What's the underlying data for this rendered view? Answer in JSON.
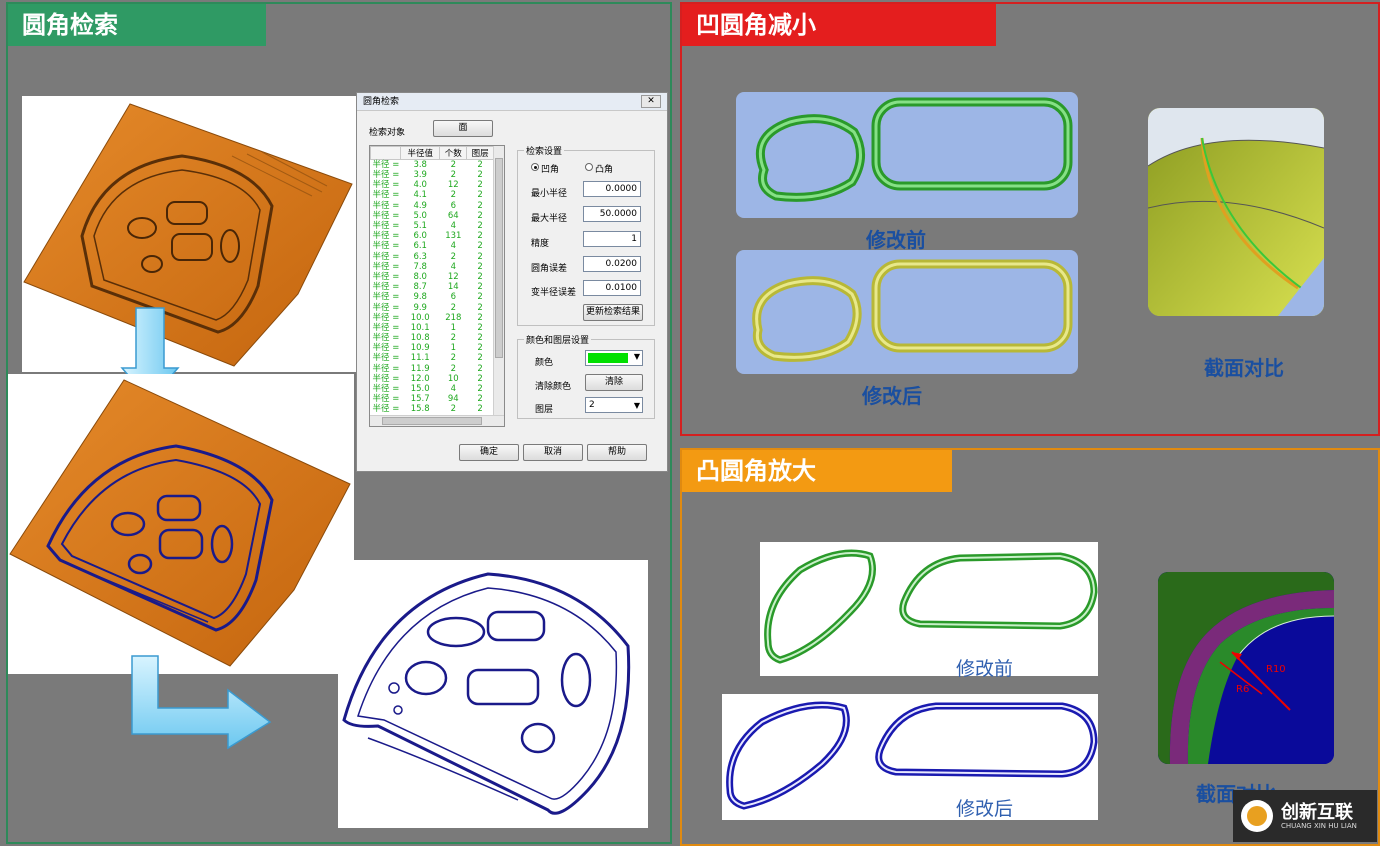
{
  "left_panel": {
    "title": "圆角检索"
  },
  "dialog": {
    "title": "圆角检索",
    "close_icon": "close-icon",
    "search_target_label": "检索对象",
    "search_target_button": "面",
    "table_headers": [
      "半径值",
      "个数",
      "图层"
    ],
    "rows": [
      {
        "k": "半径 =",
        "r": "3.8",
        "n": "2",
        "l": "2"
      },
      {
        "k": "半径 =",
        "r": "3.9",
        "n": "2",
        "l": "2"
      },
      {
        "k": "半径 =",
        "r": "4.0",
        "n": "12",
        "l": "2"
      },
      {
        "k": "半径 =",
        "r": "4.1",
        "n": "2",
        "l": "2"
      },
      {
        "k": "半径 =",
        "r": "4.9",
        "n": "6",
        "l": "2"
      },
      {
        "k": "半径 =",
        "r": "5.0",
        "n": "64",
        "l": "2"
      },
      {
        "k": "半径 =",
        "r": "5.1",
        "n": "4",
        "l": "2"
      },
      {
        "k": "半径 =",
        "r": "6.0",
        "n": "131",
        "l": "2"
      },
      {
        "k": "半径 =",
        "r": "6.1",
        "n": "4",
        "l": "2"
      },
      {
        "k": "半径 =",
        "r": "6.3",
        "n": "2",
        "l": "2"
      },
      {
        "k": "半径 =",
        "r": "7.8",
        "n": "4",
        "l": "2"
      },
      {
        "k": "半径 =",
        "r": "8.0",
        "n": "12",
        "l": "2"
      },
      {
        "k": "半径 =",
        "r": "8.7",
        "n": "14",
        "l": "2"
      },
      {
        "k": "半径 =",
        "r": "9.8",
        "n": "6",
        "l": "2"
      },
      {
        "k": "半径 =",
        "r": "9.9",
        "n": "2",
        "l": "2"
      },
      {
        "k": "半径 =",
        "r": "10.0",
        "n": "218",
        "l": "2"
      },
      {
        "k": "半径 =",
        "r": "10.1",
        "n": "1",
        "l": "2"
      },
      {
        "k": "半径 =",
        "r": "10.8",
        "n": "2",
        "l": "2"
      },
      {
        "k": "半径 =",
        "r": "10.9",
        "n": "1",
        "l": "2"
      },
      {
        "k": "半径 =",
        "r": "11.1",
        "n": "2",
        "l": "2"
      },
      {
        "k": "半径 =",
        "r": "11.9",
        "n": "2",
        "l": "2"
      },
      {
        "k": "半径 =",
        "r": "12.0",
        "n": "10",
        "l": "2"
      },
      {
        "k": "半径 =",
        "r": "15.0",
        "n": "4",
        "l": "2"
      },
      {
        "k": "半径 =",
        "r": "15.7",
        "n": "94",
        "l": "2"
      },
      {
        "k": "半径 =",
        "r": "15.8",
        "n": "2",
        "l": "2"
      }
    ],
    "search_settings": {
      "group_label": "检索设置",
      "radio_concave": "凹角",
      "radio_convex": "凸角",
      "selected": "concave",
      "min_radius_label": "最小半径",
      "min_radius": "0.0000",
      "max_radius_label": "最大半径",
      "max_radius": "50.0000",
      "precision_label": "精度",
      "precision": "1",
      "fillet_error_label": "圆角误差",
      "fillet_error": "0.0200",
      "var_radius_error_label": "变半径误差",
      "var_radius_error": "0.0100",
      "update_button": "更新检索结果"
    },
    "color_layer": {
      "group_label": "颜色和图层设置",
      "color_label": "颜色",
      "color_value": "#00e000",
      "clear_color_label": "清除颜色",
      "clear_button": "清除",
      "layer_label": "图层",
      "layer_value": "2"
    },
    "ok_button": "确定",
    "cancel_button": "取消",
    "help_button": "帮助"
  },
  "top_right": {
    "title": "凹圆角减小",
    "before_caption": "修改前",
    "after_caption": "修改后",
    "section_caption": "截面对比"
  },
  "bottom_right": {
    "title": "凸圆角放大",
    "before_caption": "修改前",
    "after_caption": "修改后",
    "section_caption": "截面对比",
    "r10_label": "R10",
    "r6_label": "R6"
  },
  "logo": {
    "text": "创新互联",
    "subtext": "CHUANG XIN HU LIAN"
  },
  "colors": {
    "left_border": "#2e8a5a",
    "red_border": "#d42020",
    "orange_border": "#e08a10",
    "hood_orange": "#d9781a",
    "outline_blue": "#1a1a8a",
    "green_fillet": "#3cb43c"
  }
}
